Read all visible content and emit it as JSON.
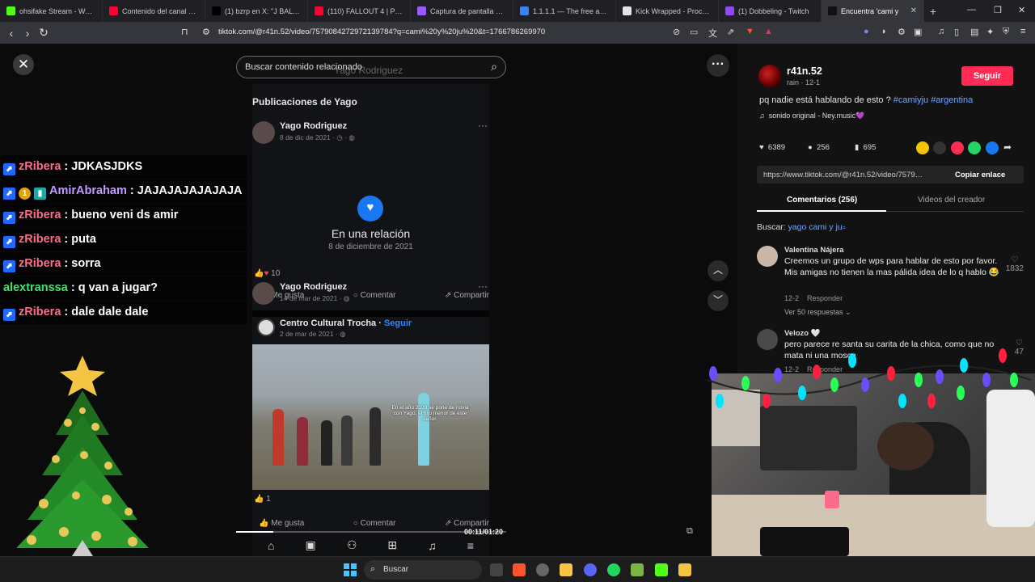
{
  "browser": {
    "tabs": [
      {
        "label": "ohsifake Stream - Watch L",
        "color": "#53fc18",
        "active": false
      },
      {
        "label": "Contenido del canal - You",
        "color": "#ff0033",
        "active": false
      },
      {
        "label": "(1) bzrp en X: \"J BALVIN |",
        "color": "#000000",
        "active": false
      },
      {
        "label": "(110) FALLOUT 4 | PRIMER",
        "color": "#ff0033",
        "active": false
      },
      {
        "label": "Captura de pantalla por Li",
        "color": "#9b5cff",
        "active": false
      },
      {
        "label": "1.1.1.1 — The free app tha",
        "color": "#3b82f6",
        "active": false
      },
      {
        "label": "Kick Wrapped - Processin",
        "color": "#e5e5e5",
        "active": false
      },
      {
        "label": "(1) Dobbeling - Twitch",
        "color": "#9146ff",
        "active": false
      },
      {
        "label": "Encuentra 'cami y",
        "color": "#111111",
        "active": true
      }
    ],
    "url": "tiktok.com/@r41n.52/video/7579084272972139784?q=cami%20y%20ju%20&t=1766786269970"
  },
  "search": {
    "placeholder": "Buscar contenido relacionado",
    "ghost_text": "Yago Rodriguez"
  },
  "video": {
    "heading": "Publicaciones de Yago",
    "post1": {
      "author": "Yago Rodriguez",
      "date": "8 de dic de 2021 · ◷ · ◍",
      "title": "En una relación",
      "subtitle": "8 de diciembre de 2021",
      "reactions": "10"
    },
    "post2": {
      "author": "Yago Rodriguez",
      "date": "14 de mar de 2021 · ◍",
      "shared_page": "Centro Cultural Trocha",
      "follow": "Seguir",
      "shared_date": "2 de mar de 2021 · ◍",
      "caption": "En el año 2020 se pone de novia con Yago, el hijo menor de este señor.",
      "reactions": "1"
    },
    "actions": {
      "like": "Me gusta",
      "comment": "Comentar",
      "share": "Compartir"
    },
    "time": "00:11/01:20",
    "progress": 0.1375
  },
  "chat": [
    {
      "user": "zRibera",
      "color": "#ff6b8a",
      "badges": [
        "prime"
      ],
      "message": "JDKASJDKS"
    },
    {
      "user": "AmirAbraham",
      "color": "#c39bff",
      "badges": [
        "prime",
        "gold",
        "teal"
      ],
      "message": "JAJAJAJAJAJAJA"
    },
    {
      "user": "zRibera",
      "color": "#ff6b8a",
      "badges": [
        "prime"
      ],
      "message": "bueno veni ds amir"
    },
    {
      "user": "zRibera",
      "color": "#ff6b8a",
      "badges": [
        "prime"
      ],
      "message": "puta"
    },
    {
      "user": "zRibera",
      "color": "#ff6b8a",
      "badges": [
        "prime"
      ],
      "message": "sorra"
    },
    {
      "user": "alextranssa",
      "color": "#3fe46b",
      "badges": [],
      "message": "q van a jugar?"
    },
    {
      "user": "zRibera",
      "color": "#ff6b8a",
      "badges": [
        "prime"
      ],
      "message": "dale dale dale"
    }
  ],
  "panel": {
    "author": "r41n.52",
    "meta": "rain · 12-1",
    "follow": "Seguir",
    "description": "pq nadie está hablando de esto ?",
    "hashtags": [
      "#camiyju",
      "#argentina"
    ],
    "sound": "sonido original - Ney.music💜",
    "likes": "6389",
    "comments": "256",
    "saves": "695",
    "link": "https://www.tiktok.com/@r41n.52/video/7579084...",
    "copy": "Copiar enlace",
    "tab_comments": "Comentarios (256)",
    "tab_videos": "Videos del creador",
    "search_label": "Buscar:",
    "search_query": "yago cami y ju",
    "comments_list": [
      {
        "name": "Valentina Nájera",
        "text": "Creemos un grupo de wps para hablar de esto por favor. Mis amigas no tienen la mas pálida idea de lo q hablo 😂",
        "date": "12-2",
        "reply": "Responder",
        "replies": "Ver 50 respuestas ⌄",
        "likes": "1832"
      },
      {
        "name": "Velozo 🤍",
        "text": "pero parece re santa su carita de la chica, como que no mata ni una mosca",
        "date": "12-2",
        "reply": "Responder",
        "likes": "47"
      }
    ]
  },
  "taskbar": {
    "search": "Buscar"
  }
}
